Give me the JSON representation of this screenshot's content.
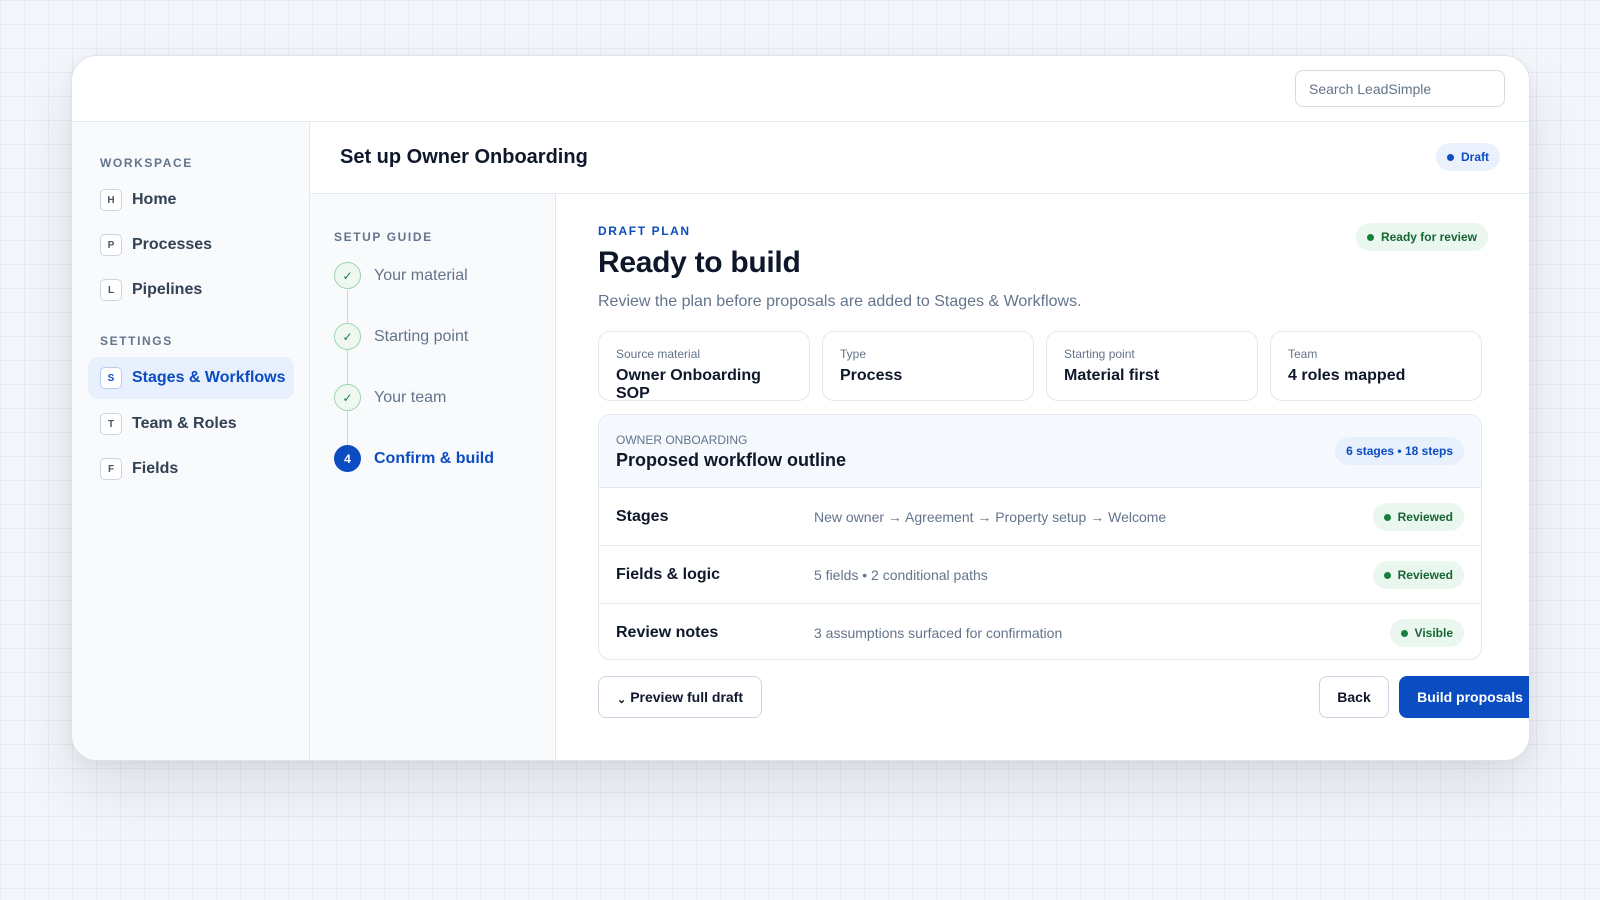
{
  "topbar": {
    "search_placeholder": "Search LeadSimple"
  },
  "sidebar": {
    "workspace_title": "WORKSPACE",
    "workspace_items": [
      {
        "key": "H",
        "label": "Home"
      },
      {
        "key": "P",
        "label": "Processes"
      },
      {
        "key": "L",
        "label": "Pipelines"
      }
    ],
    "settings_title": "SETTINGS",
    "settings_items": [
      {
        "key": "S",
        "label": "Stages & Workflows",
        "active": true
      },
      {
        "key": "T",
        "label": "Team & Roles"
      },
      {
        "key": "F",
        "label": "Fields"
      }
    ]
  },
  "header": {
    "title": "Set up Owner Onboarding",
    "status": "Draft"
  },
  "guide": {
    "title": "SETUP GUIDE",
    "steps": [
      {
        "marker": "✓",
        "label": "Your material",
        "state": "done"
      },
      {
        "marker": "✓",
        "label": "Starting point",
        "state": "done"
      },
      {
        "marker": "✓",
        "label": "Your team",
        "state": "done"
      },
      {
        "marker": "4",
        "label": "Confirm & build",
        "state": "current"
      }
    ]
  },
  "main": {
    "eyebrow": "DRAFT PLAN",
    "headline": "Ready to build",
    "status": "Ready for review",
    "subhead": "Review the plan before proposals are added to Stages & Workflows.",
    "cards": [
      {
        "label": "Source material",
        "value": "Owner Onboarding SOP"
      },
      {
        "label": "Type",
        "value": "Process"
      },
      {
        "label": "Starting point",
        "value": "Material first"
      },
      {
        "label": "Team",
        "value": "4 roles mapped"
      }
    ],
    "outline": {
      "kicker": "OWNER ONBOARDING",
      "title": "Proposed workflow outline",
      "count": "6 stages • 18 steps",
      "rows": [
        {
          "name": "Stages",
          "desc": "New owner → Agreement → Property setup → Welcome",
          "status": "Reviewed"
        },
        {
          "name": "Fields & logic",
          "desc": "5 fields • 2 conditional paths",
          "status": "Reviewed"
        },
        {
          "name": "Review notes",
          "desc": "3 assumptions surfaced for confirmation",
          "status": "Visible"
        }
      ]
    },
    "buttons": {
      "preview_chevron": "⌄",
      "preview": "Preview full draft",
      "back": "Back",
      "build": "Build proposals →"
    }
  }
}
